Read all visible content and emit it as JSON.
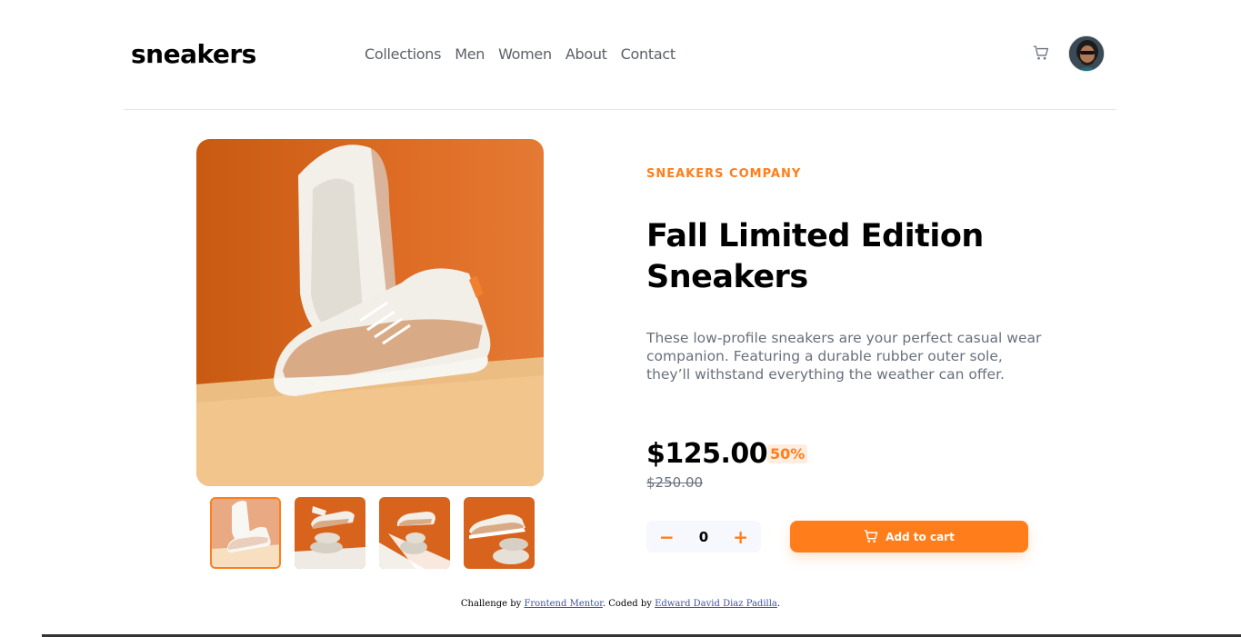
{
  "header": {
    "logo": "sneakers",
    "nav": [
      "Collections",
      "Men",
      "Women",
      "About",
      "Contact"
    ]
  },
  "product": {
    "company": "SNEAKERS COMPANY",
    "title": "Fall Limited Edition Sneakers",
    "description": "These low-profile sneakers are your perfect casual wear companion. Featuring a durable rubber outer sole, they’ll withstand everything the weather can offer.",
    "price": "$125.00",
    "discount": "50%",
    "old_price": "$250.00",
    "quantity": "0",
    "minus": "−",
    "plus": "+",
    "add_to_cart": "Add to cart"
  },
  "footer": {
    "text1": "Challenge by ",
    "link1": "Frontend Mentor",
    "text2": ". Coded by ",
    "link2": "Edward David Diaz Padilla",
    "text3": "."
  },
  "colors": {
    "accent": "#ff7e1b",
    "accent_pale": "#ffede0",
    "text_dark": "#000000",
    "text_gray": "#68707d"
  },
  "icons": [
    "cart-icon",
    "avatar"
  ]
}
